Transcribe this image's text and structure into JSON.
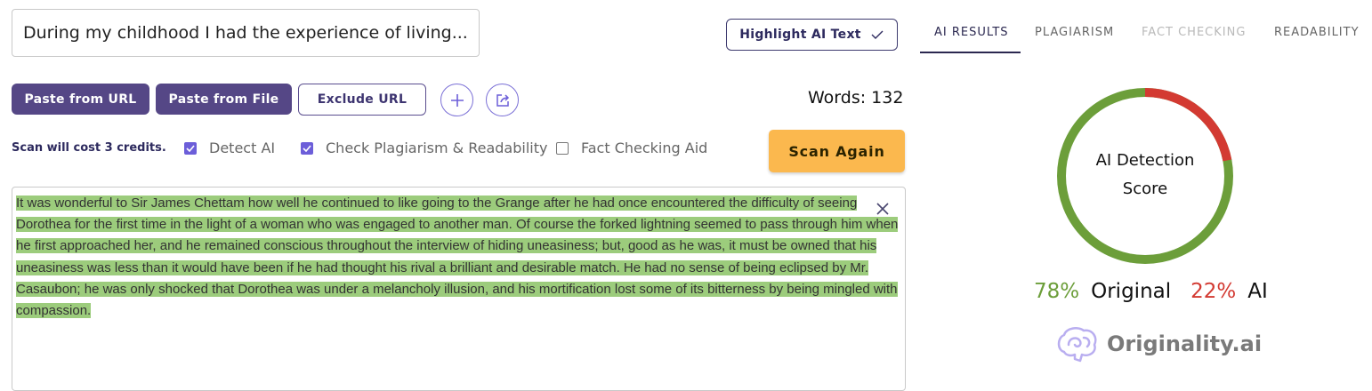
{
  "title_input": {
    "value": "During my childhood I had the experience of living..."
  },
  "toolbar": {
    "highlight_label": "Highlight AI Text",
    "paste_url_label": "Paste from URL",
    "paste_file_label": "Paste from File",
    "exclude_url_label": "Exclude URL",
    "add_icon": "plus-icon",
    "share_icon": "share-icon"
  },
  "word_count": {
    "label": "Words: 132"
  },
  "scan_options": {
    "cost_text": "Scan will cost 3 credits.",
    "options": [
      {
        "label": "Detect AI",
        "checked": true
      },
      {
        "label": "Check Plagiarism & Readability",
        "checked": true
      },
      {
        "label": "Fact Checking Aid",
        "checked": false
      }
    ],
    "scan_button_label": "Scan Again"
  },
  "content": {
    "text": "It was wonderful to Sir James Chettam how well he continued to like going to the Grange after he had once encountered the difficulty of seeing Dorothea for the first time in the light of a woman who was engaged to another man. Of course the forked lightning seemed to pass through him when he first approached her, and he remained conscious throughout the interview of hiding uneasiness; but, good as he was, it must be owned that his uneasiness was less than it would have been if he had thought his rival a brilliant and desirable match. He had no sense of being eclipsed by Mr. Casaubon; he was only shocked that Dorothea was under a melancholy illusion, and his mortification lost some of its bitterness by being mingled with compassion.",
    "highlight_color": "#9ccc7c"
  },
  "tabs": [
    {
      "label": "AI RESULTS",
      "state": "active"
    },
    {
      "label": "PLAGIARISM",
      "state": "normal"
    },
    {
      "label": "FACT CHECKING",
      "state": "disabled"
    },
    {
      "label": "READABILITY",
      "state": "normal"
    }
  ],
  "results": {
    "donut_line1": "AI Detection",
    "donut_line2": "Score",
    "original_percent": "78%",
    "original_label": "Original",
    "ai_percent": "22%",
    "ai_label": "AI",
    "original_fraction": 0.78,
    "ai_fraction": 0.22,
    "original_color": "#6c9e3a",
    "ai_color": "#d33a32"
  },
  "brand": {
    "name": "Originality.ai",
    "icon": "brain-logo-icon"
  }
}
